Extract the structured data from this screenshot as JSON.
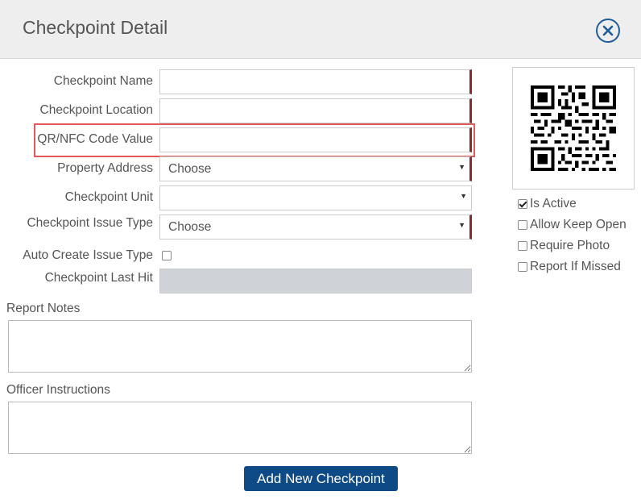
{
  "header": {
    "title": "Checkpoint Detail",
    "close_icon": "close-circle-icon"
  },
  "form": {
    "checkpoint_name": {
      "label": "Checkpoint Name",
      "value": ""
    },
    "checkpoint_location": {
      "label": "Checkpoint Location",
      "value": ""
    },
    "qr_nfc_code_value": {
      "label": "QR/NFC Code Value",
      "value": ""
    },
    "property_address": {
      "label": "Property Address",
      "selected": "Choose"
    },
    "checkpoint_unit": {
      "label": "Checkpoint Unit",
      "selected": ""
    },
    "checkpoint_issue_type": {
      "label": "Checkpoint Issue Type",
      "selected": "Choose"
    },
    "auto_create_issue_type": {
      "label": "Auto Create Issue Type",
      "checked": false
    },
    "checkpoint_last_hit": {
      "label": "Checkpoint Last Hit",
      "value": ""
    },
    "report_notes": {
      "label": "Report Notes",
      "value": ""
    },
    "officer_instructions": {
      "label": "Officer Instructions",
      "value": ""
    }
  },
  "options": [
    {
      "label": "Is Active",
      "checked": true
    },
    {
      "label": "Allow Keep Open",
      "checked": false
    },
    {
      "label": "Require Photo",
      "checked": false
    },
    {
      "label": "Report If Missed",
      "checked": false
    }
  ],
  "actions": {
    "add_label": "Add New Checkpoint"
  },
  "colors": {
    "accent": "#0e4a85",
    "required_marker": "#8b2a2a",
    "highlight": "#e05a5a"
  }
}
